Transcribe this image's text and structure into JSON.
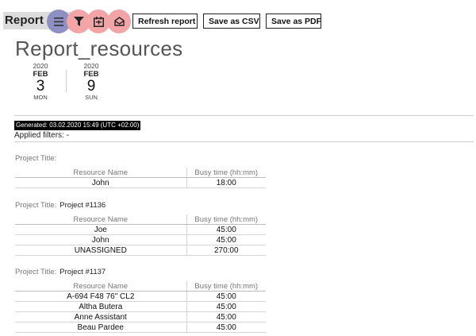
{
  "toolbar": {
    "title": "Report",
    "tools": [
      {
        "name": "menu-icon",
        "color": "#8e8fc2"
      },
      {
        "name": "filter-icon",
        "color": "#f3a4a6"
      },
      {
        "name": "calendar-icon",
        "color": "#f3a4a6"
      },
      {
        "name": "mail-icon",
        "color": "#f3a4a6"
      }
    ],
    "refresh_label": "Refresh report",
    "csv_label": "Save as CSV",
    "pdf_label": "Save as PDF"
  },
  "report": {
    "title": "Report_resources",
    "date_start": {
      "year": "2020",
      "month": "FEB",
      "day": "3",
      "weekday": "MON"
    },
    "date_end": {
      "year": "2020",
      "month": "FEB",
      "day": "9",
      "weekday": "SUN"
    },
    "generated": "Generated: 03.02.2020 15:49 (UTC +02:00)",
    "applied_filters": "Applied filters: -"
  },
  "projects": [
    {
      "label": "Project Title:",
      "name": "",
      "columns": [
        "Resource Name",
        "Busy time (hh:mm)"
      ],
      "rows": [
        [
          "John",
          "18:00"
        ]
      ]
    },
    {
      "label": "Project Title:",
      "name": "Project #1136",
      "columns": [
        "Resource Name",
        "Busy time (hh:mm)"
      ],
      "rows": [
        [
          "Joe",
          "45:00"
        ],
        [
          "John",
          "45:00"
        ],
        [
          "UNASSIGNED",
          "270:00"
        ]
      ]
    },
    {
      "label": "Project Title:",
      "name": "Project #1137",
      "columns": [
        "Resource Name",
        "Busy time (hh:mm)"
      ],
      "rows": [
        [
          "A-694 F48 76\" CL2",
          "45:00"
        ],
        [
          "Altha Butera",
          "45:00"
        ],
        [
          "Anne Assistant",
          "45:00"
        ],
        [
          "Beau Pardee",
          "45:00"
        ]
      ]
    }
  ]
}
